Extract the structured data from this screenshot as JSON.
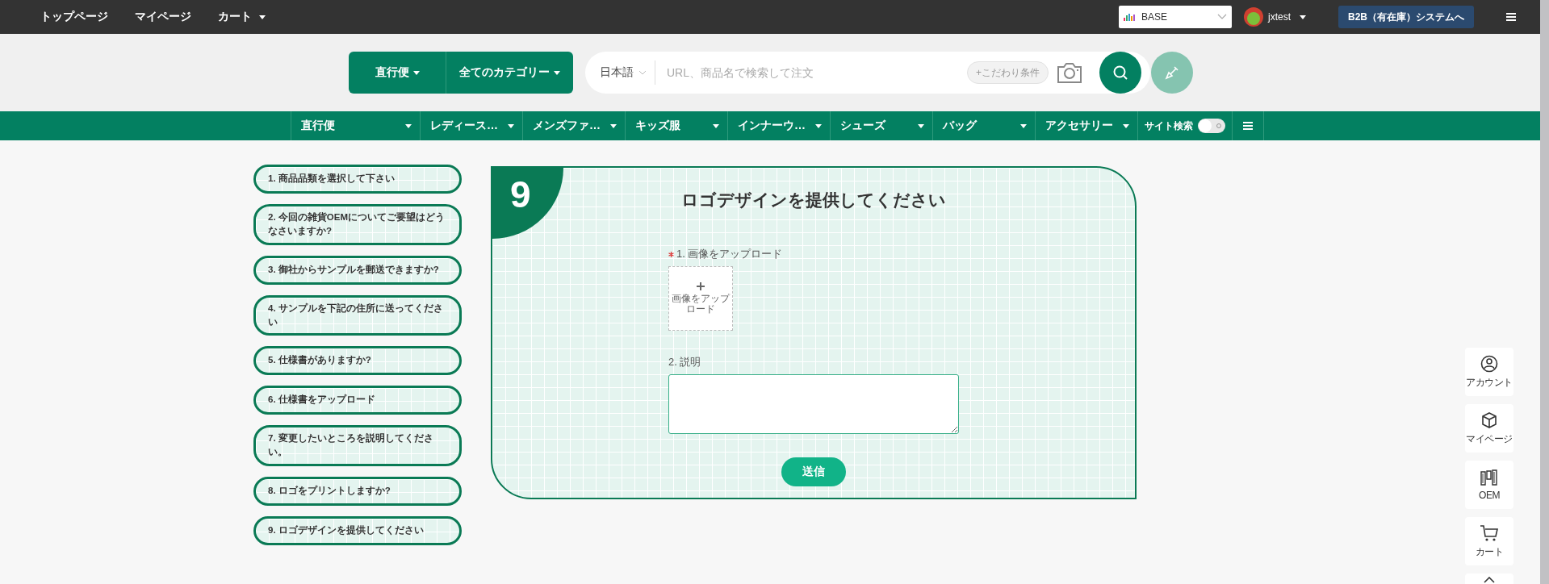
{
  "top_nav": {
    "links": [
      {
        "label": "トップページ",
        "caret": false
      },
      {
        "label": "マイページ",
        "caret": false
      },
      {
        "label": "カート",
        "caret": true
      }
    ],
    "store_select": {
      "value": "BASE"
    },
    "user": {
      "name": "jxtest"
    },
    "system_button": "B2B（有在庫）システムへ"
  },
  "search": {
    "mode_button": "直行便",
    "category_button": "全てのカテゴリー",
    "language": "日本語",
    "placeholder": "URL、商品名で検索して注文",
    "filter_chip": "+こだわり条件"
  },
  "category_nav": {
    "items": [
      {
        "label": "直行便"
      },
      {
        "label": "レディース…"
      },
      {
        "label": "メンズファ…"
      },
      {
        "label": "キッズ服"
      },
      {
        "label": "インナーウ…"
      },
      {
        "label": "シューズ"
      },
      {
        "label": "バッグ"
      },
      {
        "label": "アクセサリー"
      }
    ],
    "site_search": {
      "label": "サイト検索",
      "on": false
    }
  },
  "steps": [
    {
      "label": "1. 商品品類を選択して下さい"
    },
    {
      "label": "2. 今回の雑貨OEMについてご要望はどうなさいますか?"
    },
    {
      "label": "3. 御社からサンプルを郵送できますか?"
    },
    {
      "label": "4. サンプルを下記の住所に送ってください"
    },
    {
      "label": "5. 仕様書がありますか?"
    },
    {
      "label": "6. 仕様書をアップロード"
    },
    {
      "label": "7. 変更したいところを説明してください。"
    },
    {
      "label": "8. ロゴをプリントしますか?"
    },
    {
      "label": "9. ロゴデザインを提供してください"
    }
  ],
  "card": {
    "number": "9",
    "title": "ロゴデザインを提供してください",
    "fields": [
      {
        "kind": "upload",
        "required": true,
        "label": "1. 画像をアップロード",
        "button_text": "画像をアップロード"
      },
      {
        "kind": "textarea",
        "required": false,
        "label": "2. 説明"
      }
    ],
    "submit": "送信"
  },
  "side_tools": [
    {
      "label": "アカウント"
    },
    {
      "label": "マイページ"
    },
    {
      "label": "OEM"
    },
    {
      "label": "カート"
    }
  ]
}
